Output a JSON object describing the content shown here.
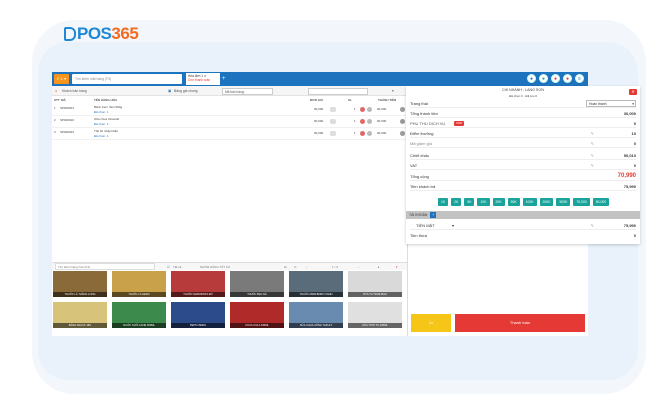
{
  "brand": {
    "logo_main": "POS",
    "logo_num": "365"
  },
  "topbar": {
    "brand_btn": "F-1 ▾",
    "search_placeholder": "Tìm kiếm mặt hàng (F3)",
    "tab_line1": "Hóa đơn 1 ✕",
    "tab_line2": "Chờ thanh toán",
    "add_tab": "+"
  },
  "toolbar": {
    "customer": "Khách bán hàng",
    "price_list": "Bảng giá chung",
    "sales_label": "Mã bán hàng:"
  },
  "table": {
    "headers": [
      "STT",
      "MÃ",
      "TÊN HÀNG HÓA",
      "ĐƠN GIÁ",
      "SL",
      "THÀNH TIỀN"
    ],
    "rows": [
      {
        "stt": "1",
        "code": "SP000001",
        "name": "Bánh Kem Vani 500g",
        "sub": "Đã chọn: 1",
        "price": "90,000",
        "qty": "1",
        "total": "90,000"
      },
      {
        "stt": "2",
        "code": "SP000010",
        "name": "Sữa chua Vinamilk",
        "sub": "Đã chọn: 1",
        "price": "90,000",
        "qty": "1",
        "total": "90,000"
      },
      {
        "stt": "3",
        "code": "SP000022",
        "name": "Thịt bò nhập khẩu",
        "sub": "Đã chọn: 1",
        "price": "90,000",
        "qty": "1",
        "total": "90,000"
      }
    ]
  },
  "product_search": {
    "placeholder": "Tìm kiếm hàng hóa (F4)",
    "filter": "Tất cả",
    "group": "NHÓM HÀNG TẤT CẢ",
    "page": "1 / 3"
  },
  "products": [
    "THUỐC LÁ THĂNG LONG",
    "THUỐC LÁ HERO",
    "THUỐC MARLBORO ĐỎ",
    "THUỐC BẠC HÀ",
    "THUỐC MARLBORO XANH",
    "SỮA TH TRUE MILK",
    "BÁNH SNACK 18G",
    "NƯỚC SUỐI LAVIE 500ML",
    "PEPSI 390ML",
    "COCA COLA 330ML",
    "SỮA CHUA UỐNG YAKULT",
    "SỮA TƯƠI TH 180ML"
  ],
  "panel": {
    "title": "CHI NHÁNH - LẠNG SƠN",
    "subtitle": "Đã chọn 0 · Đã lưu 0",
    "close": "✕",
    "status_label": "Trạng thái",
    "status_value": "Hoàn thành",
    "rows": [
      {
        "label": "Tổng thành tiền",
        "value": "30,000"
      },
      {
        "label": "PHỤ THU DỊCH VỤ",
        "value": "0",
        "tag": "VND"
      },
      {
        "label": "Điểm thưởng",
        "value": "10"
      },
      {
        "label": "Mã giảm giá",
        "value": "0"
      },
      {
        "label": "Chiết khấu",
        "value": "50,010"
      },
      {
        "label": "VAT",
        "value": "0"
      },
      {
        "label": "Tổng cộng",
        "value": "70,990"
      },
      {
        "label": "Tiền khách trả",
        "value": "75,990"
      }
    ],
    "quick_amounts": [
      "1K",
      "2K",
      "5K",
      "10K",
      "20K",
      "50K",
      "100K",
      "200K",
      "500K",
      "75,000",
      "80,000"
    ],
    "account_label": "TÀI KHOẢN",
    "account_plus": "+",
    "method_label": "TIỀN MẶT",
    "method_value": "75,990",
    "change_label": "Tiền thừa",
    "change_value": "0"
  },
  "buttons": {
    "secondary": "In",
    "primary": "Thanh toán"
  },
  "colors": {
    "primary": "#1e73be",
    "accent": "#f26b21",
    "danger": "#e53935",
    "teal": "#1aa39a",
    "yellow": "#f5c518"
  }
}
